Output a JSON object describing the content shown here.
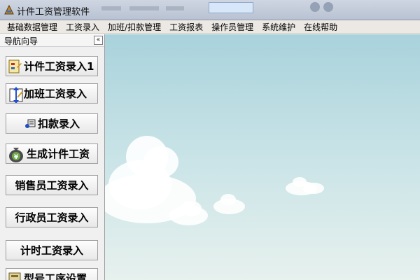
{
  "app": {
    "title": "计件工资管理软件",
    "icon": "app-logo-icon"
  },
  "menubar": {
    "items": [
      "基础数据管理",
      "工资录入",
      "加班/扣款管理",
      "工资报表",
      "操作员管理",
      "系统维护",
      "在线帮助"
    ]
  },
  "sidebar": {
    "title": "导航向导",
    "collapse_glyph": "«",
    "buttons": [
      {
        "label": "计件工资录入1",
        "icon": "piece-wage-icon"
      },
      {
        "label": "加班工资录入",
        "icon": "overtime-icon"
      },
      {
        "label": "扣款录入",
        "icon": "deduction-icon"
      },
      {
        "label": "生成计件工资",
        "icon": "money-bag-icon"
      },
      {
        "label": "销售员工资录入"
      },
      {
        "label": "行政员工资录入"
      },
      {
        "label": "计时工资录入"
      },
      {
        "label": "型号工序设置",
        "icon": "process-settings-icon"
      }
    ]
  },
  "colors": {
    "sky_top": "#a9d2dc",
    "sky_bottom": "#e7f1ee",
    "menubar": "#ece9e4"
  }
}
